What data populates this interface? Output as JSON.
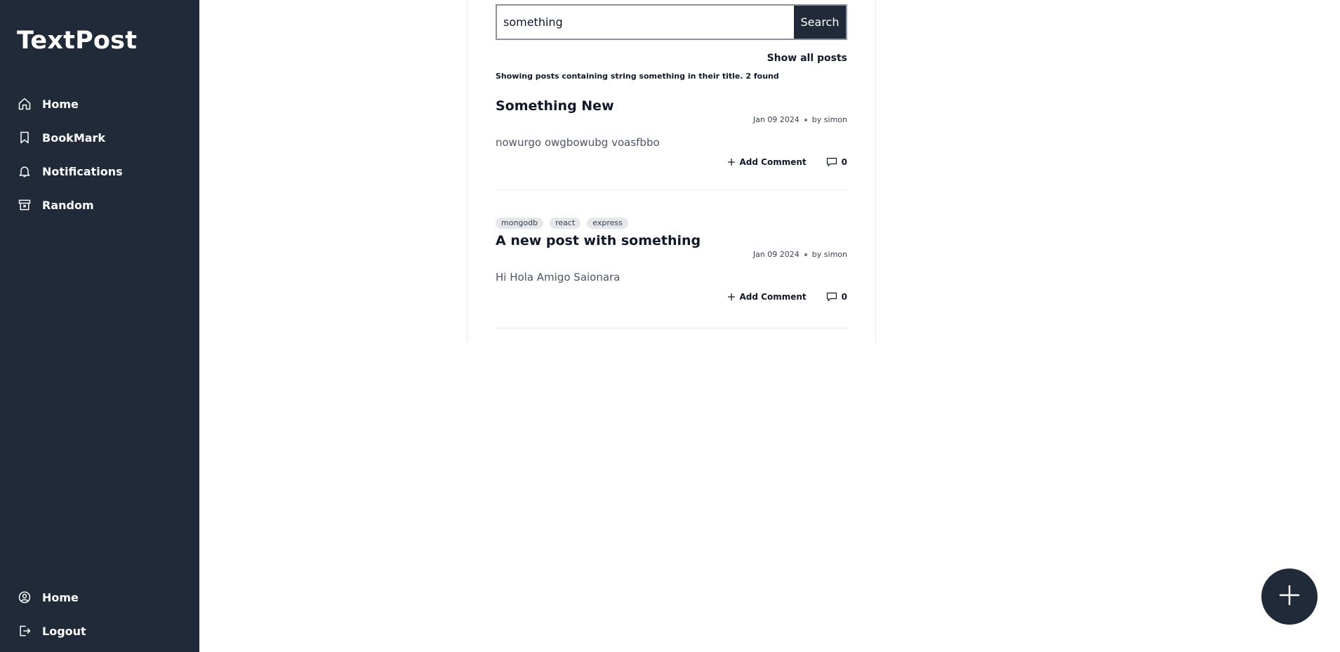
{
  "sidebar": {
    "logo": "TextPost",
    "nav": [
      {
        "label": "Home",
        "icon": "home-icon"
      },
      {
        "label": "BookMark",
        "icon": "bookmark-icon"
      },
      {
        "label": "Notifications",
        "icon": "bell-icon"
      },
      {
        "label": "Random",
        "icon": "archive-icon"
      }
    ],
    "bottom_nav": [
      {
        "label": "Home",
        "icon": "user-circle-icon"
      },
      {
        "label": "Logout",
        "icon": "logout-icon"
      }
    ]
  },
  "search": {
    "value": "something",
    "button_label": "Search"
  },
  "show_all_label": "Show all posts",
  "result_info": "Showing posts containing string something in their title. 2 found",
  "posts": [
    {
      "tags": [],
      "title": "Something New",
      "date": "Jan 09 2024",
      "author": "by simon",
      "body": "nowurgo owgbowubg voasfbbo",
      "add_comment_label": "Add Comment",
      "comment_count": "0"
    },
    {
      "tags": [
        "mongodb",
        "react",
        "express"
      ],
      "title": "A new post with something",
      "date": "Jan 09 2024",
      "author": "by simon",
      "body": "Hi Hola Amigo Saionara",
      "add_comment_label": "Add Comment",
      "comment_count": "0"
    }
  ],
  "fab_icon": "plus-icon",
  "colors": {
    "sidebar_bg": "#212a38",
    "accent": "#212a38",
    "tag_bg": "#e5e7eb"
  }
}
